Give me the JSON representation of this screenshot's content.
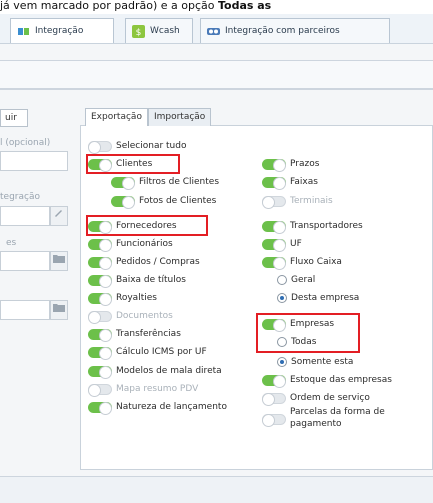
{
  "caption": {
    "pre": "já vem marcado por padrão) e a opção ",
    "bold": "Todas as"
  },
  "main_tabs": [
    {
      "label": "Integração",
      "icon": "integration-icon"
    },
    {
      "label": "Wcash",
      "icon": "wcash-icon"
    },
    {
      "label": "Integração com parceiros",
      "icon": "partners-icon"
    }
  ],
  "left_fragments": {
    "button": "uir",
    "label1": "l (opcional)",
    "label2": "tegração",
    "label3": "es"
  },
  "sub_tabs": {
    "export": "Exportação",
    "import": "Importação"
  },
  "left_column": {
    "select_all": "Selecionar tudo",
    "clientes": "Clientes",
    "filtros_clientes": "Filtros de Clientes",
    "fotos_clientes": "Fotos de Clientes",
    "fornecedores": "Fornecedores",
    "funcionarios": "Funcionários",
    "pedidos": "Pedidos / Compras",
    "baixa": "Baixa de títulos",
    "royalties": "Royalties",
    "documentos": "Documentos",
    "transferencias": "Transferências",
    "icms": "Cálculo ICMS por UF",
    "mala_direta": "Modelos de mala direta",
    "resumo_pdv": "Mapa resumo PDV",
    "natureza": "Natureza de lançamento"
  },
  "right_column": {
    "prazos": "Prazos",
    "faixas": "Faixas",
    "terminais": "Terminais",
    "transportadores": "Transportadores",
    "uf": "UF",
    "fluxo_caixa": "Fluxo Caixa",
    "geral": "Geral",
    "desta_empresa": "Desta empresa",
    "empresas": "Empresas",
    "todas": "Todas",
    "somente_esta": "Somente esta",
    "estoque": "Estoque das empresas",
    "ordem_servico": "Ordem de serviço",
    "parcelas_1": "Parcelas da forma de",
    "parcelas_2": "pagamento"
  },
  "colors": {
    "toggle_on": "#6cc04a",
    "highlight": "#e31e24"
  }
}
